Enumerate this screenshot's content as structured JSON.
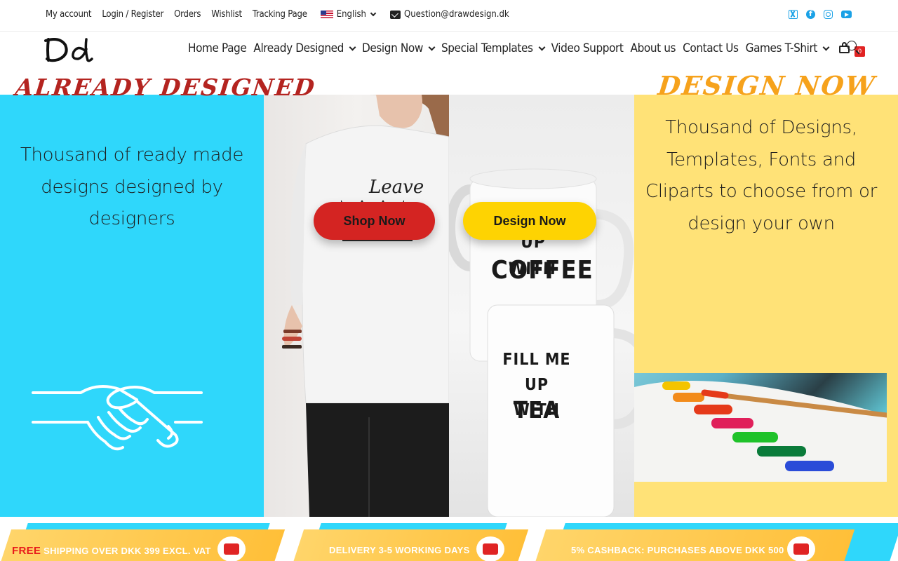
{
  "topbar": {
    "links": [
      "My account",
      "Login / Register",
      "Orders",
      "Wishlist",
      "Tracking Page"
    ],
    "language": "English",
    "email": "Question@drawdesign.dk",
    "socials": [
      "x-icon",
      "facebook-icon",
      "instagram-icon",
      "youtube-icon"
    ],
    "social_color": "#1aa1e6"
  },
  "header": {
    "logo": "Dd",
    "nav": [
      {
        "label": "Home Page",
        "dropdown": false
      },
      {
        "label": "Already Designed",
        "dropdown": true
      },
      {
        "label": "Design Now",
        "dropdown": true
      },
      {
        "label": "Special Templates",
        "dropdown": true
      },
      {
        "label": "Video Support",
        "dropdown": false
      },
      {
        "label": "About us",
        "dropdown": false
      },
      {
        "label": "Contact Us",
        "dropdown": false
      },
      {
        "label": "Games T-Shirt",
        "dropdown": true
      }
    ],
    "cart_count": "0"
  },
  "hero": {
    "left_title": "Already Designed",
    "left_text": "Thousand of ready made designs designed by designers",
    "shop_button": "Shop Now",
    "design_button": "Design Now",
    "mug_top_line1": "FILL ME UP",
    "mug_top_line2": "WITH",
    "mug_top_line3": "COFFEE",
    "mug_bottom_line1": "FILL ME UP",
    "mug_bottom_line2": "WITH",
    "mug_bottom_line3": "TEA",
    "right_title": "Design Now",
    "right_text": "Thousand of Designs, Templates, Fonts and Cliparts to choose from or design your own",
    "colors": {
      "cyan": "#2fd7fb",
      "yellow": "#ffe277",
      "red": "#d42422",
      "gold": "#fed302"
    }
  },
  "banner": {
    "free": "FREE",
    "shipping": "SHIPPING OVER DKK 399 EXCL. VAT",
    "delivery": "DELIVERY 3-5 WORKING DAYS",
    "cashback": "5% CASHBACK: PURCHASES ABOVE DKK 500"
  }
}
